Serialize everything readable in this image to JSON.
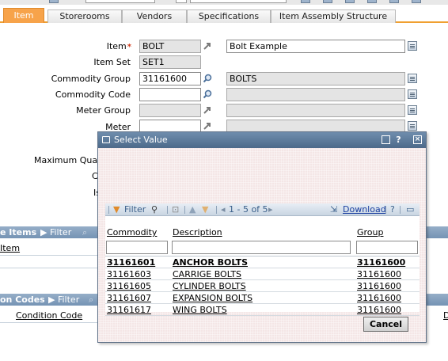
{
  "tabs": [
    {
      "label": "Item",
      "active": true
    },
    {
      "label": "Storerooms",
      "active": false
    },
    {
      "label": "Vendors",
      "active": false
    },
    {
      "label": "Specifications",
      "active": false
    },
    {
      "label": "Item Assembly Structure",
      "active": false
    }
  ],
  "form": {
    "item_label": "Item",
    "item_required_marker": "*",
    "item_value": "BOLT",
    "item_description": "Bolt Example",
    "itemset_label": "Item Set",
    "itemset_value": "SET1",
    "commodity_group_label": "Commodity Group",
    "commodity_group_value": "31161600",
    "commodity_group_description": "BOLTS",
    "commodity_code_label": "Commodity Code",
    "commodity_code_value": "",
    "meter_group_label": "Meter Group",
    "meter_group_value": "",
    "meter_label": "Meter",
    "meter_value": "",
    "max_qty_label": "Maximum Quanti",
    "partial_label_1": "C",
    "partial_label_2": "Is"
  },
  "background": {
    "section1_title": "e Items",
    "section1_filter": "Filter",
    "section1_col": "Item",
    "section2_title": "on Codes",
    "section2_filter": "Filter",
    "section2_col": "Condition Code",
    "section2_edge": "D"
  },
  "dialog": {
    "title": "Select Value",
    "filter_label": "Filter",
    "pagination": "1 - 5 of 5",
    "download_label": "Download",
    "help_label": "?",
    "columns": [
      "Commodity",
      "Description",
      "Group"
    ],
    "rows": [
      {
        "commodity": "31161601",
        "description": "ANCHOR BOLTS",
        "group": "31161600",
        "selected": true
      },
      {
        "commodity": "31161603",
        "description": "CARRIGE BOLTS",
        "group": "31161600",
        "selected": false
      },
      {
        "commodity": "31161605",
        "description": "CYLINDER BOLTS",
        "group": "31161600",
        "selected": false
      },
      {
        "commodity": "31161607",
        "description": "EXPANSION BOLTS",
        "group": "31161600",
        "selected": false
      },
      {
        "commodity": "31161617",
        "description": "WING BOLTS",
        "group": "31161600",
        "selected": false
      }
    ],
    "cancel_label": "Cancel"
  },
  "colors": {
    "tab_active": "#f7a34a",
    "section_header": "#7f9cbc",
    "dialog_title": "#5a7798",
    "dialog_body": "#f4e6e6",
    "required": "#d03a1a"
  }
}
